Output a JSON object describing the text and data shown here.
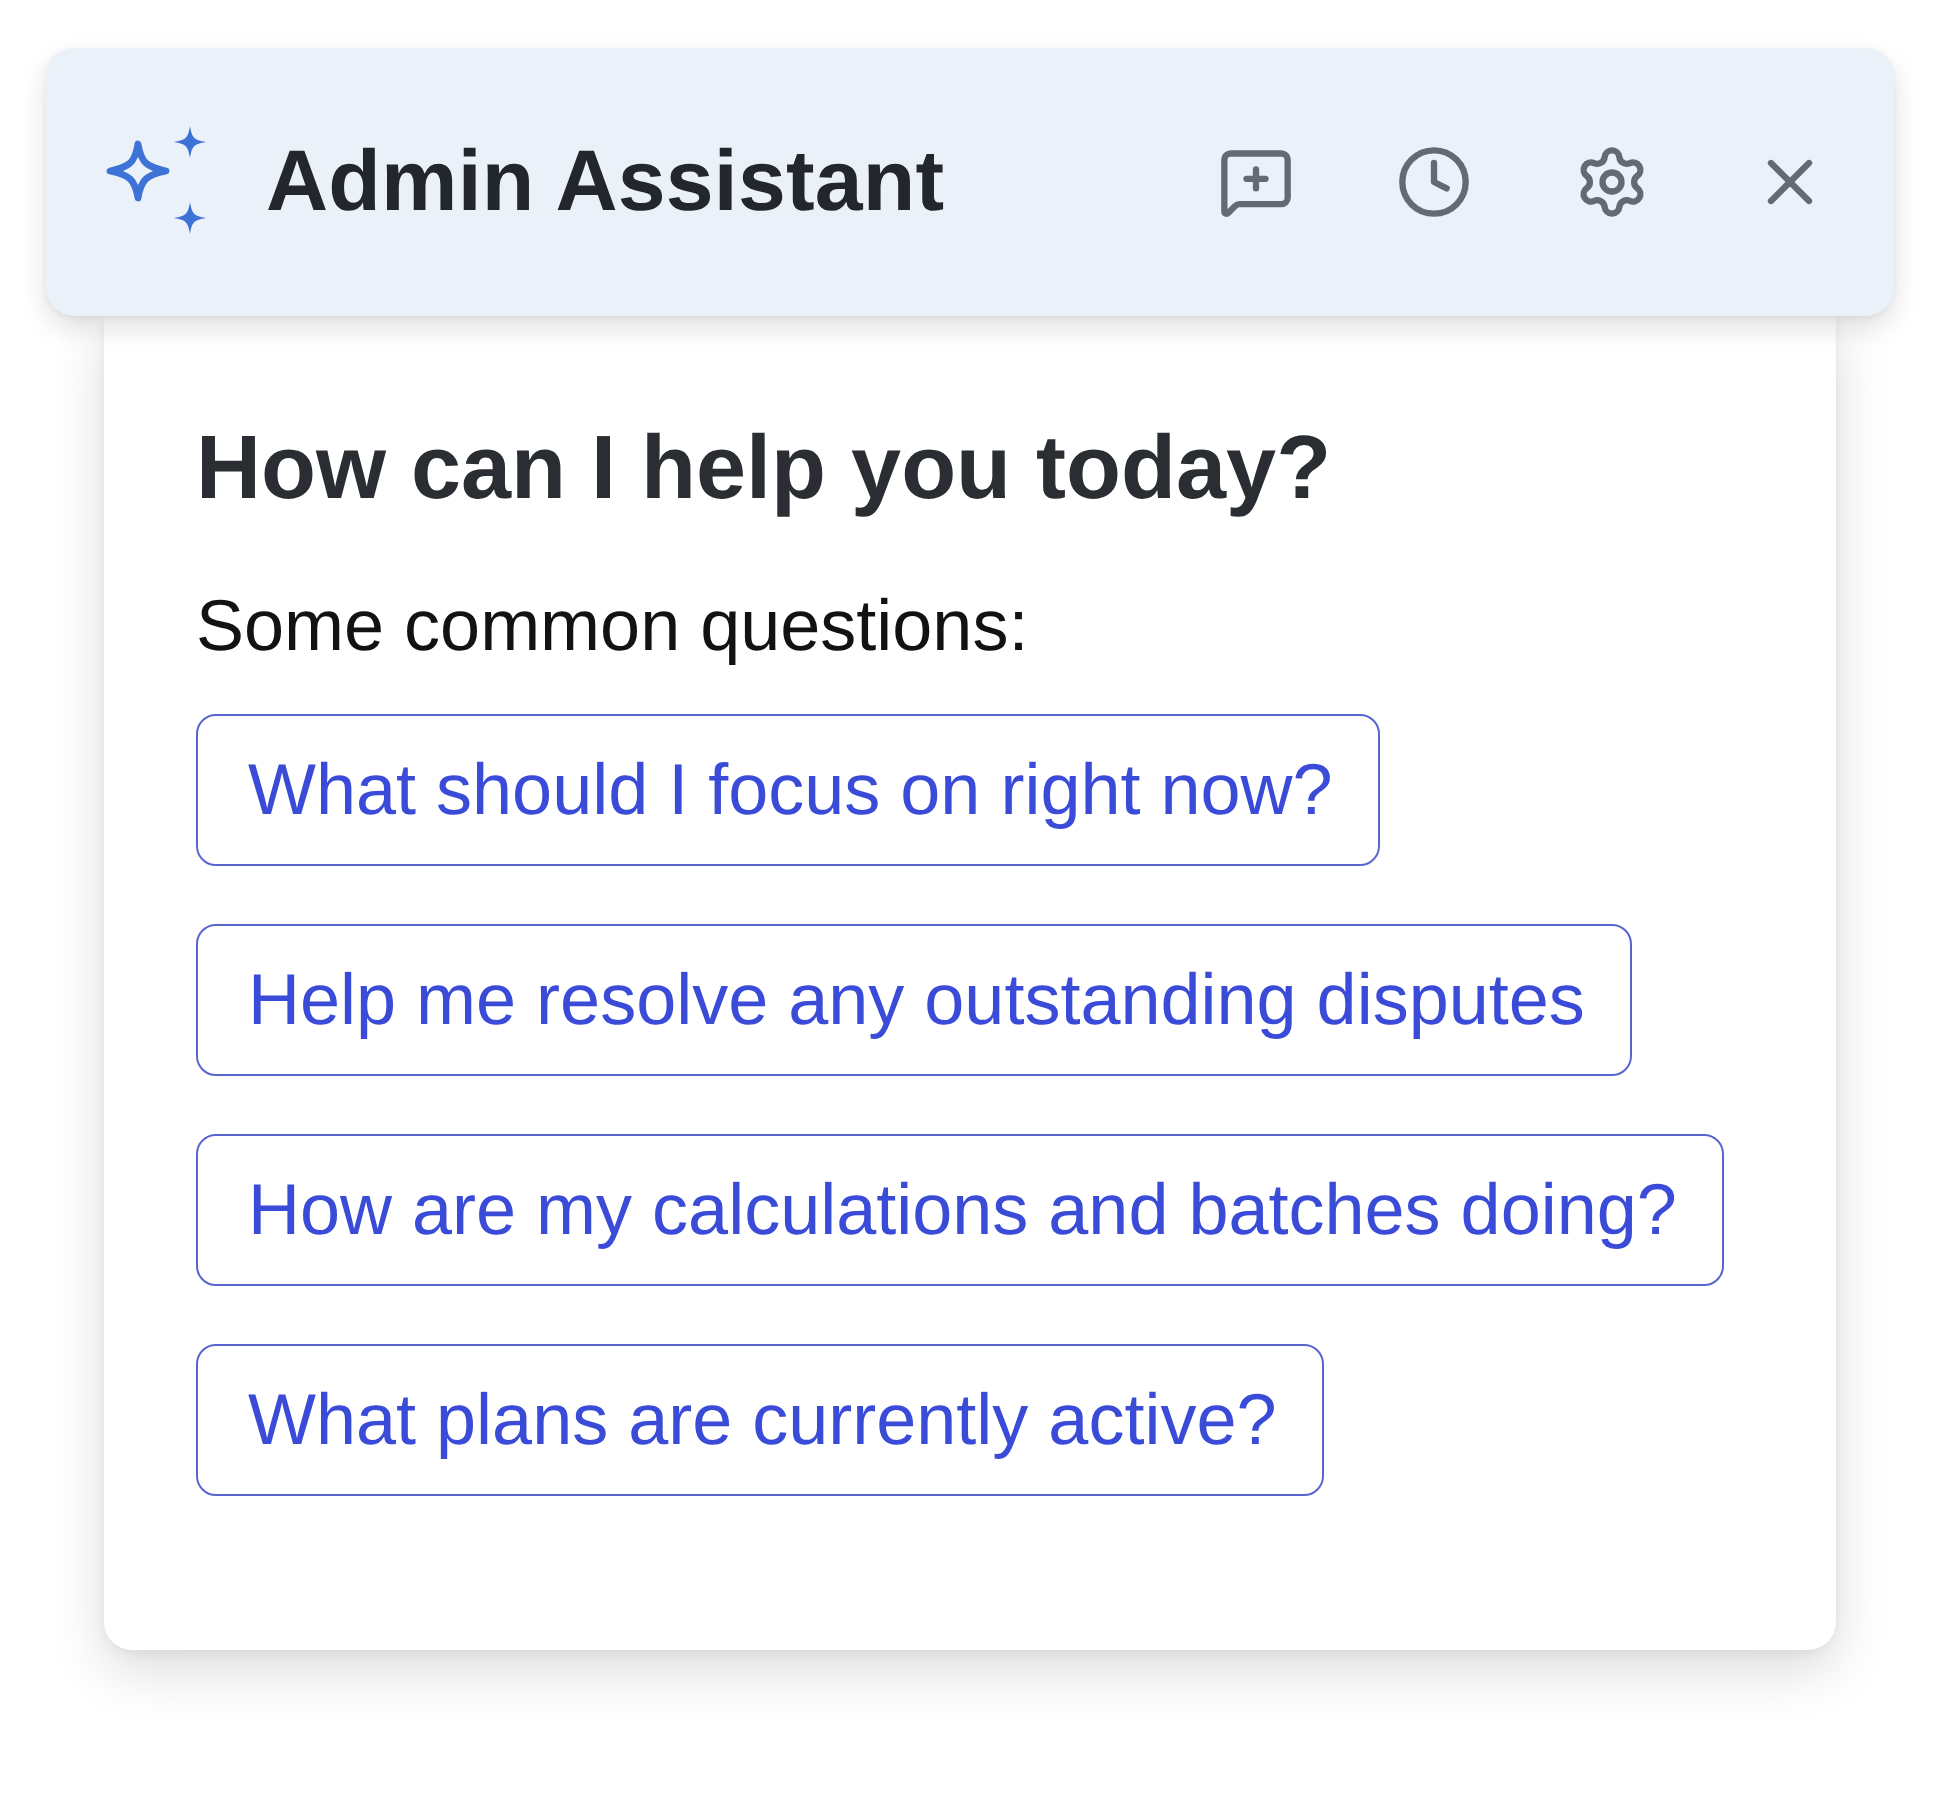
{
  "header": {
    "title": "Admin Assistant"
  },
  "body": {
    "heading": "How can I help you today?",
    "subheading": "Some common questions:",
    "suggestions": [
      "What should I focus on right now?",
      "Help me resolve any outstanding disputes",
      "How are my calculations and batches doing?",
      "What plans are currently active?"
    ]
  }
}
